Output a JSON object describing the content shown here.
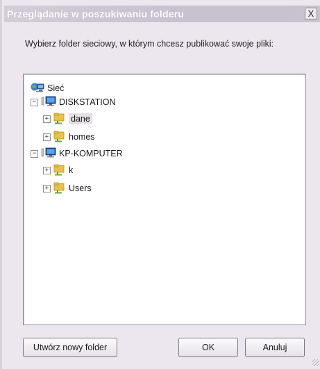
{
  "window": {
    "title": "Przeglądanie w poszukiwaniu folderu",
    "close_label": "X"
  },
  "instruction": "Wybierz folder sieciowy, w którym chcesz publikować swoje pliki:",
  "tree": {
    "root": {
      "label": "Sieć",
      "icon": "network-icon"
    },
    "hosts": [
      {
        "label": "DISKSTATION",
        "icon": "computer-icon",
        "expander": "−",
        "children": [
          {
            "label": "dane",
            "icon": "shared-folder-icon",
            "expander": "+",
            "selected": true
          },
          {
            "label": "homes",
            "icon": "shared-folder-icon",
            "expander": "+"
          }
        ]
      },
      {
        "label": "KP-KOMPUTER",
        "icon": "computer-icon",
        "expander": "−",
        "children": [
          {
            "label": "k",
            "icon": "shared-folder-icon",
            "expander": "+"
          },
          {
            "label": "Users",
            "icon": "shared-folder-icon",
            "expander": "+"
          }
        ]
      }
    ]
  },
  "buttons": {
    "new_folder": "Utwórz nowy folder",
    "ok": "OK",
    "cancel": "Anuluj"
  },
  "colors": {
    "titlebar": "#c9c3d0",
    "dialog_bg": "#ece7ee",
    "selection": "#e4e0e6"
  }
}
